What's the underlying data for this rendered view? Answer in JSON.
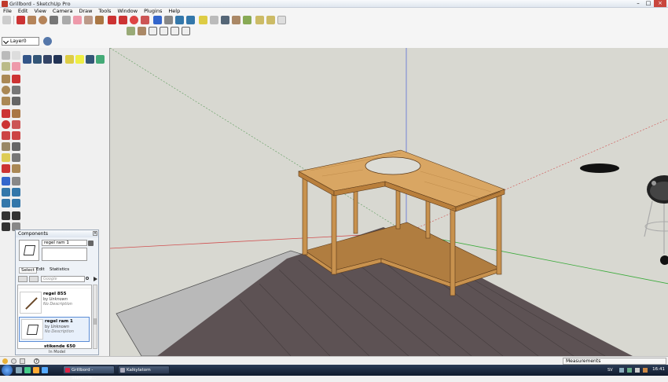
{
  "window": {
    "title": "Grillbord - SketchUp Pro"
  },
  "menu": [
    "File",
    "Edit",
    "View",
    "Camera",
    "Draw",
    "Tools",
    "Window",
    "Plugins",
    "Help"
  ],
  "toolbar": {
    "layer_value": "Layer0"
  },
  "components": {
    "title": "Components",
    "name_value": "regel ram 1",
    "tabs": [
      "Select",
      "Edit",
      "Statistics"
    ],
    "search_placeholder": "Google",
    "items": [
      {
        "name": "regel 855",
        "by": "by",
        "author": "Unknown",
        "desc": "No Description"
      },
      {
        "name": "regel ram 1",
        "by": "by",
        "author": "Unknown",
        "desc": "No Description"
      },
      {
        "name": "stikende 650"
      }
    ],
    "footer": "In Model"
  },
  "status": {
    "measurements_label": "Measurements"
  },
  "taskbar": {
    "items": [
      "Grillbord - SketchUp...",
      "Kalkylatorn"
    ],
    "lang": "SV",
    "clock": "16:41"
  },
  "colors": {
    "viewport_bg": "#d8d8d1",
    "wood": "#c8924e",
    "floor": "#5c5050"
  }
}
